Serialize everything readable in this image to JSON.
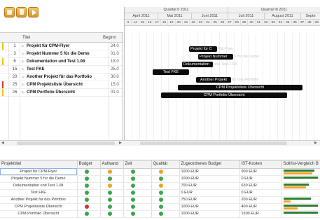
{
  "toolbar": {
    "buttons": [
      "folder-icon",
      "document-icon",
      "flag-icon"
    ]
  },
  "gantt": {
    "columns": {
      "title": "Titel",
      "begin": "Beginn"
    },
    "rows": [
      {
        "flag": "y",
        "num": "1",
        "title": "Projekt für CPM-Flyer",
        "begin": "24.0"
      },
      {
        "flag": "",
        "num": "3",
        "title": "Projekt Nummer 5 für die Demo",
        "begin": "01.0"
      },
      {
        "flag": "y",
        "num": "6",
        "title": "Dokumentation und Test 1.08",
        "begin": "18.0"
      },
      {
        "flag": "",
        "num": "15",
        "title": "Test FKE",
        "begin": "25.0"
      },
      {
        "flag": "",
        "num": "20",
        "title": "Another Projekt für das Portfolio",
        "begin": "30.0"
      },
      {
        "flag": "r",
        "num": "25",
        "title": "CPM Projektsliste Übersicht",
        "begin": "15.0"
      },
      {
        "flag": "y",
        "num": "26",
        "title": "CPM Portfolio Übersicht",
        "begin": "01.0"
      }
    ],
    "quarters": [
      "Quartal II 2011",
      "Quartal III 2011"
    ],
    "months": [
      "April 2011",
      "Mai 2011",
      "Juni 2011",
      "Juli 2011",
      "August 2011",
      "Septe"
    ],
    "days": [
      "3",
      "14",
      "15",
      "16",
      "17",
      "18",
      "19",
      "20",
      "21",
      "22",
      "23",
      "24",
      "25",
      "26",
      "27",
      "28",
      "29",
      "30",
      "31",
      "32",
      "33",
      "34",
      "35",
      "36",
      "37",
      "38",
      "39"
    ],
    "bars": [
      {
        "label": "Projekt für C",
        "ghost": "PM-Flyer"
      },
      {
        "label": "Projekt Nummer",
        "ghost": " 5 für die Demo"
      },
      {
        "label": "Dokumentation",
        "ghost": " und Test 1.08"
      },
      {
        "label": "Test FKE",
        "ghost": ""
      },
      {
        "label": "Another Projekt",
        "ghost": " für das Portfolio"
      },
      {
        "label": "CPM Projektsliste Übersicht",
        "ghost": ""
      },
      {
        "label": "CPM Portfolio Übersicht",
        "ghost": ""
      }
    ]
  },
  "table": {
    "headers": [
      "Projekttitel",
      "Budget",
      "Aufwand",
      "Zeit",
      "Qualität",
      "Zugeordnetes Budget",
      "IST-Kosten",
      "Soll/Ist-Vergleich B"
    ],
    "rows": [
      {
        "title": "Projekt für CPM-Flyer",
        "budget": "green",
        "aufwand": "orange",
        "zeit": "green",
        "qualitaet": "orange",
        "zb": "1000 EUR",
        "ist": "900 EUR",
        "soll": 0.85,
        "istv": 0.8
      },
      {
        "title": "Projekt Nummer 5 für die Demo",
        "budget": "green",
        "aufwand": "green",
        "zeit": "green",
        "qualitaet": "green",
        "zb": "1000 EUR",
        "ist": "0 EUR",
        "soll": 0.95,
        "istv": 0.0
      },
      {
        "title": "Dokumentation und Test 1.08",
        "budget": "green",
        "aufwand": "orange",
        "zeit": "green",
        "qualitaet": "orange",
        "zb": "700 EUR",
        "ist": "630 EUR",
        "soll": 0.7,
        "istv": 0.62
      },
      {
        "title": "Test FKE",
        "budget": "green",
        "aufwand": "green",
        "zeit": "green",
        "qualitaet": "green",
        "zb": "0 EUR",
        "ist": "0 EUR",
        "soll": 0.0,
        "istv": 0.0
      },
      {
        "title": "Another Projekt für das Portfolio",
        "budget": "green",
        "aufwand": "green",
        "zeit": "green",
        "qualitaet": "green",
        "zb": "750 EUR",
        "ist": "200 EUR",
        "soll": 0.75,
        "istv": 0.2
      },
      {
        "title": "CPM Projektsliste Übersicht",
        "budget": "red",
        "aufwand": "green",
        "zeit": "green",
        "qualitaet": "green",
        "zb": "1000 EUR",
        "ist": "400 EUR",
        "soll": 0.95,
        "istv": 0.4
      },
      {
        "title": "CPM Portfolio Übersicht",
        "budget": "green",
        "aufwand": "green",
        "zeit": "green",
        "qualitaet": "green",
        "zb": "1000 EUR",
        "ist": "1500 EUR",
        "soll": 0.95,
        "istv": 0.0
      }
    ]
  }
}
